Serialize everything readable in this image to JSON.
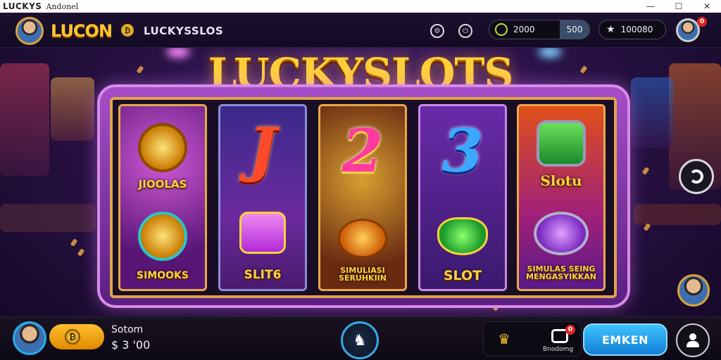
{
  "window": {
    "title": "LUCKYS",
    "subtitle": "Andonel",
    "minimize": "—",
    "maximize": "☐",
    "close": "✕"
  },
  "topbar": {
    "logo": "LUCON",
    "coin_glyph": "₿",
    "app_name": "LUCKYSSLOS",
    "settings_icon": "gear-icon",
    "power_icon": "power-icon",
    "balance_value": "2000",
    "balance_extra": "500",
    "star_value": "100080",
    "notification_count": "0"
  },
  "game": {
    "title": "LUCKYSLOTS",
    "reels": [
      {
        "top_label": "JIOOLAS",
        "bottom_label": "SIMOOKS"
      },
      {
        "top_digit": "J",
        "bottom_label": "SLIT6"
      },
      {
        "top_digit": "2",
        "bottom_label": "SIMULIASI SERUHKIIN"
      },
      {
        "top_digit": "3",
        "bottom_label": "SLOT"
      },
      {
        "top_label": "Slotu",
        "bottom_label": "SIMULAS SEING MENGASYIKKAN"
      }
    ]
  },
  "bottombar": {
    "player_name": "Sotom",
    "player_balance": "$ 3 '00",
    "coin_glyph": "₿",
    "mid_label": "Bnodomg",
    "mid_badge": "0",
    "action_button": "EMKEN"
  },
  "colors": {
    "accent_gold": "#ffc52a",
    "frame_purple": "#a64ec9",
    "spin_blue": "#38a9ea",
    "badge_red": "#e32121"
  }
}
